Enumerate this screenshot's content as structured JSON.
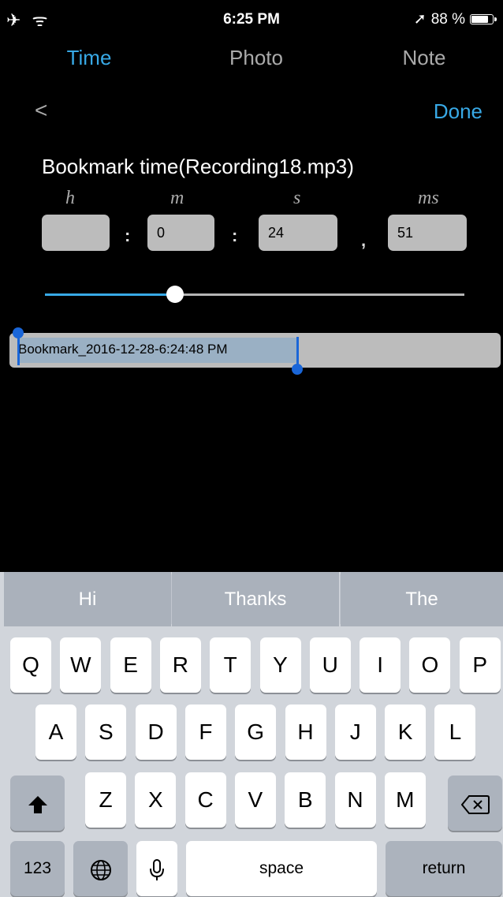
{
  "status": {
    "left_icons": "✈ ᯤ",
    "time": "6:25 PM",
    "location_icon": "➚",
    "battery": "88 %",
    "battery_level": 0.88
  },
  "tabs": [
    {
      "label": "Time",
      "active": true
    },
    {
      "label": "Photo",
      "active": false
    },
    {
      "label": "Note",
      "active": false
    }
  ],
  "nav": {
    "back": "<",
    "done": "Done"
  },
  "bookmark": {
    "title": "Bookmark time(Recording18.mp3)",
    "units": [
      "h",
      "m",
      "s",
      "ms"
    ],
    "fields": [
      "",
      "0",
      "24",
      "51"
    ],
    "separators": [
      ":",
      ":",
      ","
    ],
    "slider_position": 0.31,
    "name_text": "Bookmark_2016-12-28-6:24:48 PM"
  },
  "suggestions": [
    "Hi",
    "Thanks",
    "The"
  ],
  "keyboard": {
    "row1": [
      "Q",
      "W",
      "E",
      "R",
      "T",
      "Y",
      "U",
      "I",
      "O",
      "P"
    ],
    "row2": [
      "A",
      "S",
      "D",
      "F",
      "G",
      "H",
      "J",
      "K",
      "L"
    ],
    "row3": [
      "Z",
      "X",
      "C",
      "V",
      "B",
      "N",
      "M"
    ],
    "numbers": "123",
    "space": "space",
    "return": "return"
  },
  "colors": {
    "accent": "#38a9e6",
    "selection": "#1a66d8"
  }
}
